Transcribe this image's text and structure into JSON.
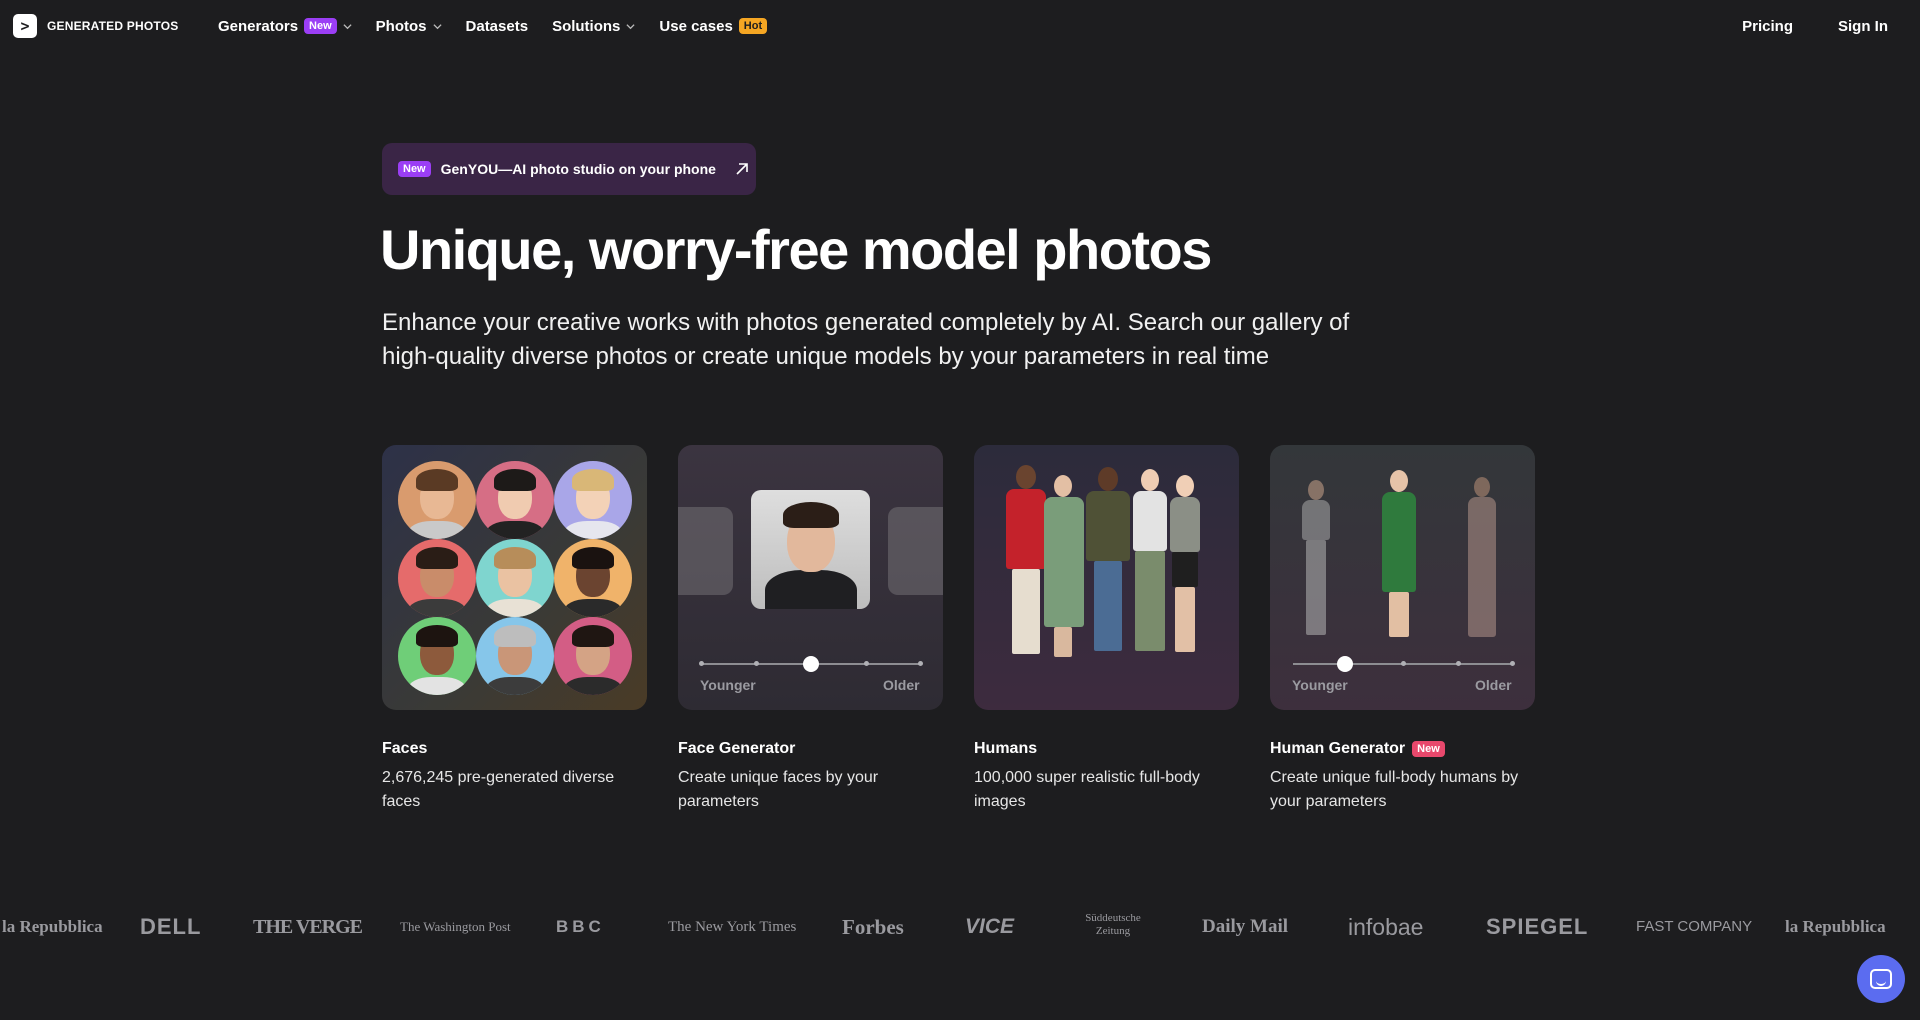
{
  "brand": {
    "name": "GENERATED PHOTOS",
    "mark": ">"
  },
  "nav": {
    "items": [
      {
        "label": "Generators",
        "tag": "New",
        "dropdown": true
      },
      {
        "label": "Photos",
        "dropdown": true
      },
      {
        "label": "Datasets",
        "dropdown": false
      },
      {
        "label": "Solutions",
        "dropdown": true
      },
      {
        "label": "Use cases",
        "tag": "Hot",
        "dropdown": false
      }
    ],
    "pricing": "Pricing",
    "sign_in": "Sign In"
  },
  "promo": {
    "tag": "New",
    "text": "GenYOU—AI photo studio on your phone"
  },
  "hero": {
    "title": "Unique, worry-free model photos",
    "subtitle": "Enhance your creative works with photos generated completely by AI. Search our gallery of high-quality diverse photos or create unique models by your parameters in real time"
  },
  "cards": [
    {
      "title": "Faces",
      "desc": "2,676,245 pre-generated diverse faces"
    },
    {
      "title": "Face Generator",
      "desc": "Create unique faces by your parameters",
      "slider_min": "Younger",
      "slider_max": "Older"
    },
    {
      "title": "Humans",
      "desc": "100,000 super realistic full-body images"
    },
    {
      "title": "Human Generator",
      "tag": "New",
      "desc": "Create unique full-body humans by your parameters",
      "slider_min": "Younger",
      "slider_max": "Older"
    }
  ],
  "press_logos": [
    "la Repubblica",
    "DELL",
    "THE VERGE",
    "The Washington Post",
    "BBC",
    "The New York Times",
    "Forbes",
    "VICE",
    "Süddeutsche Zeitung",
    "Daily Mail",
    "infobae",
    "SPIEGEL",
    "FAST COMPANY",
    "la Repubblica"
  ],
  "colors": {
    "background": "#1d1d1f",
    "accent_purple": "#9b3ef5",
    "hot_orange": "#f5a623",
    "new_red": "#e8486c",
    "chat_blue": "#5b6cf0"
  }
}
